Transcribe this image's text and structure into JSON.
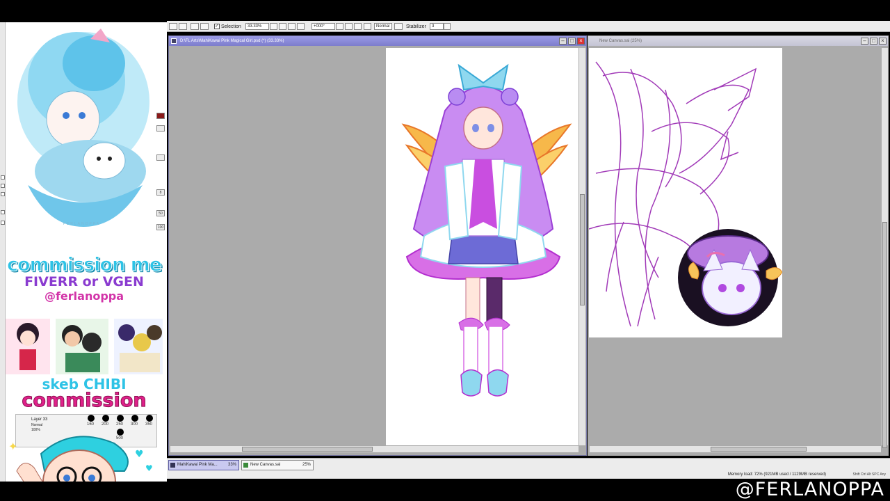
{
  "toolbar": {
    "selection_label": "Selection",
    "zoom": "33.33%",
    "rotation": "+000°",
    "blend_mode": "Normal",
    "stabilizer_label": "Stabilizer",
    "stabilizer_value": "3"
  },
  "windows": [
    {
      "title": "D:\\FL Arts\\MahiKawai Pink Magical Girl.psd (*) (33.33%)",
      "active": true
    },
    {
      "title": "New Canvas.sai (25%)",
      "active": false
    }
  ],
  "taskbar": {
    "tabs": [
      {
        "label": "MahiKawai Pink Ma...",
        "zoom": "33%"
      },
      {
        "label": "New Canvas.sai",
        "zoom": "25%"
      }
    ]
  },
  "status": {
    "memory": "Memory load: 72% (921MB used / 1129MB reserved)",
    "indicators": "Shift Ctrl Alt SPC Any"
  },
  "overlay": {
    "commission_title": "commission me",
    "commission_platforms": "FIVERR or VGEN",
    "commission_handle": "@ferlanoppa",
    "skeb_title": "skeb CHIBI",
    "skeb_sub": "commission",
    "preview_signature": "FERLANOPPA",
    "left_tool_labels": [
      "8",
      "50",
      "100",
      "50%",
      "68"
    ],
    "layer_name": "Layer 33",
    "layer_mode": "Normal",
    "layer_opacity": "100%",
    "brush_sizes": [
      "160",
      "200",
      "250",
      "300",
      "350",
      "500"
    ]
  },
  "watermark": "@FERLANOPPA",
  "colors": {
    "accent_pink": "#e0218a",
    "accent_cyan": "#2ec3e6",
    "accent_purple": "#8a3bd0",
    "titlebar_active": "#8888d6",
    "titlebar_inactive": "#c8c8d8"
  }
}
